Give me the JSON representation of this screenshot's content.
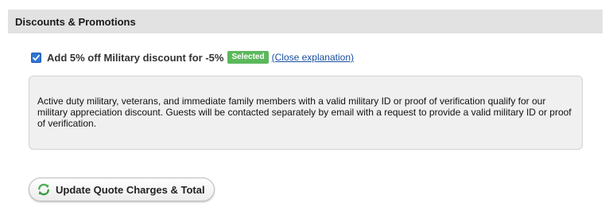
{
  "section": {
    "title": "Discounts & Promotions"
  },
  "discount": {
    "checked": true,
    "label": "Add 5% off Military discount for -5%",
    "badge": "Selected",
    "toggle_link": "(Close explanation)"
  },
  "explanation": {
    "text": "Active duty military, veterans, and immediate family members with a valid military ID or proof of verification qualify for our military appreciation discount. Guests will be contacted separately by email with a request to provide a valid military ID or proof of verification."
  },
  "actions": {
    "update_button": "Update Quote Charges & Total",
    "update_icon": "refresh-icon"
  },
  "colors": {
    "header_bg": "#e2e2e2",
    "badge_bg": "#5cb85c",
    "link": "#1a4fa0",
    "checkbox": "#2f76d2",
    "icon_green": "#4caf50"
  }
}
